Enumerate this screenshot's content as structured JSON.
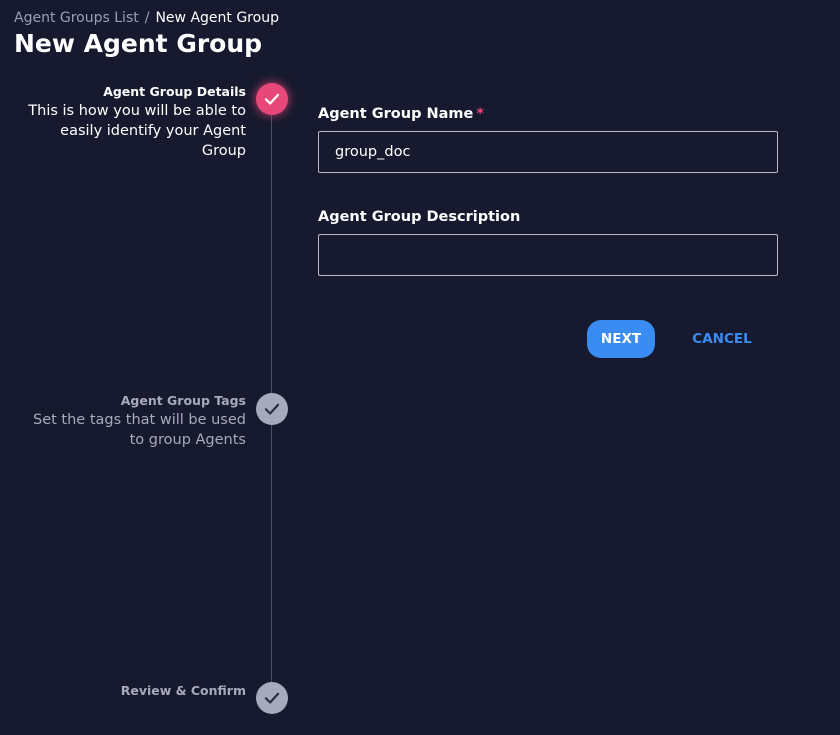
{
  "breadcrumb": {
    "parent": "Agent Groups List",
    "separator": "/",
    "current": "New Agent Group"
  },
  "page_title": "New Agent Group",
  "steps": [
    {
      "title": "Agent Group Details",
      "description": "This is how you will be able to easily identify your Agent Group",
      "state": "active",
      "icon": "check-icon"
    },
    {
      "title": "Agent Group Tags",
      "description": "Set the tags that will be used to group Agents",
      "state": "pending",
      "icon": "check-icon"
    },
    {
      "title": "Review & Confirm",
      "description": "",
      "state": "pending",
      "icon": "check-icon"
    }
  ],
  "form": {
    "name_label": "Agent Group Name",
    "name_required_mark": "*",
    "name_value": "group_doc",
    "description_label": "Agent Group Description",
    "description_value": ""
  },
  "actions": {
    "next_label": "NEXT",
    "cancel_label": "CANCEL"
  },
  "colors": {
    "background": "#171a2e",
    "accent_pink": "#e8477a",
    "primary_blue": "#3b8cf2",
    "muted_text": "#a7a9bd"
  }
}
